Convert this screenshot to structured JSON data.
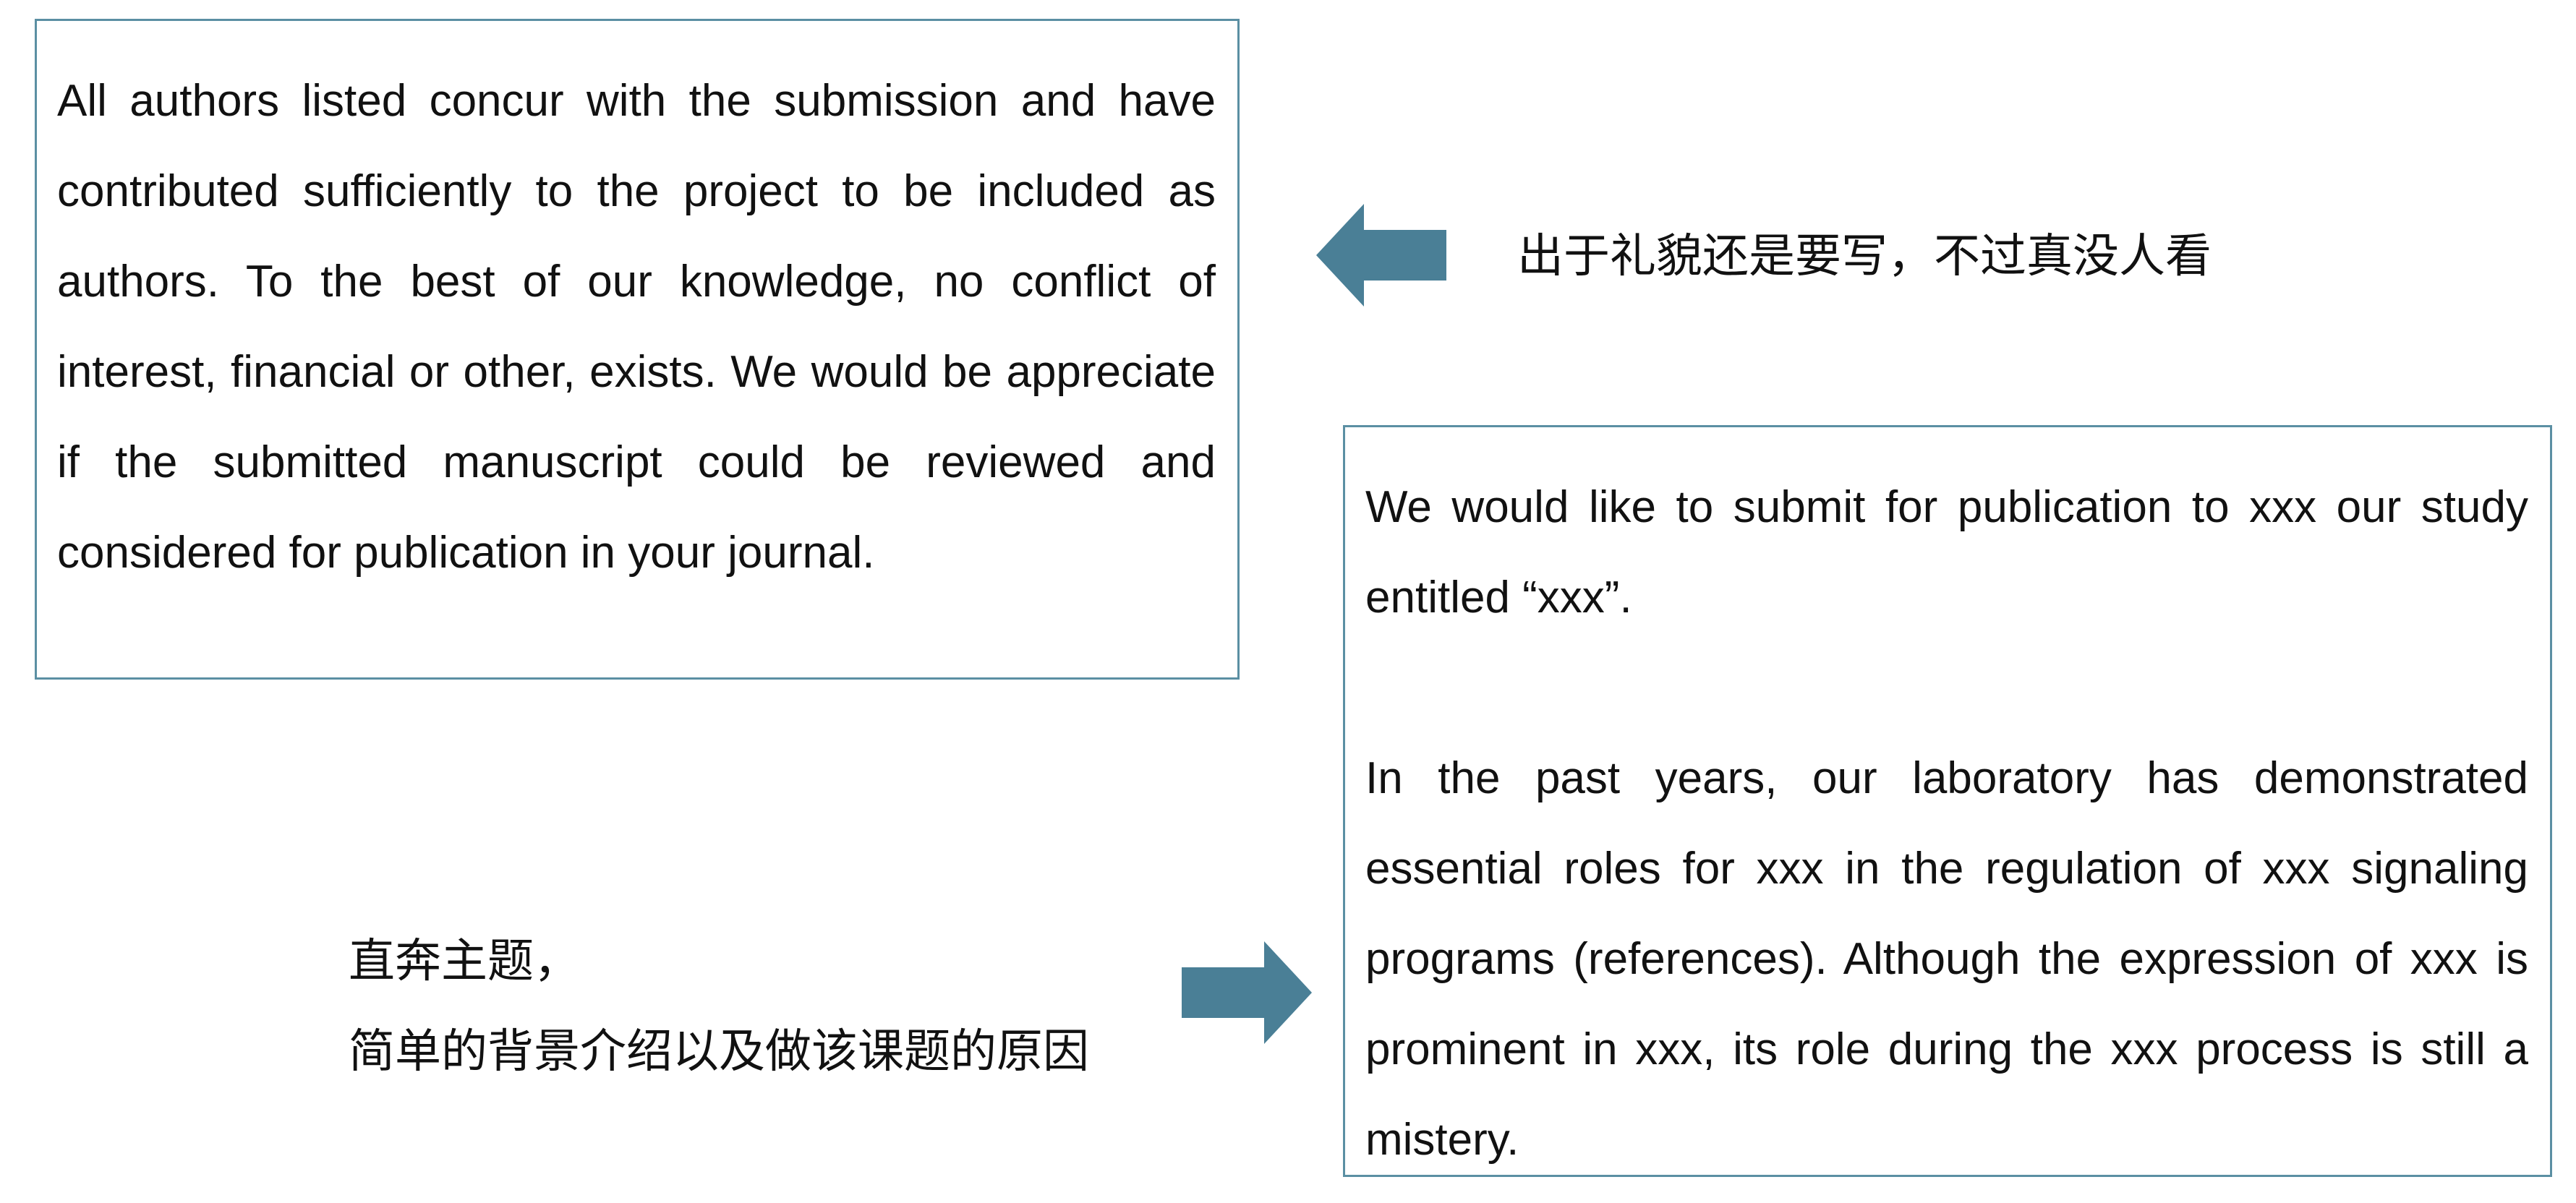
{
  "left_box": {
    "text": "All authors listed concur with the submission and have contributed sufficiently to the project to be included as authors. To the best of our knowledge, no conflict of interest, financial or other, exists. We would be appreciate if the submitted manuscript could be reviewed and considered for publication in your journal."
  },
  "right_box": {
    "paragraph_1": "We would like to submit for publication to xxx our study entitled “xxx”.",
    "paragraph_2": "In the past years, our laboratory has demonstrated essential roles for xxx in the regulation of xxx signaling programs (references). Although the expression of xxx is prominent in xxx, its role during the xxx process is still a mistery."
  },
  "annotations": {
    "top": "出于礼貌还是要写，不过真没人看",
    "bottom_line_1": "直奔主题，",
    "bottom_line_2": "简单的背景介绍以及做该课题的原因"
  },
  "icons": {
    "arrow_top": "arrow-left-icon",
    "arrow_bottom": "arrow-right-icon"
  },
  "colors": {
    "accent": "#4a7f96",
    "border": "#5b8fa3"
  }
}
